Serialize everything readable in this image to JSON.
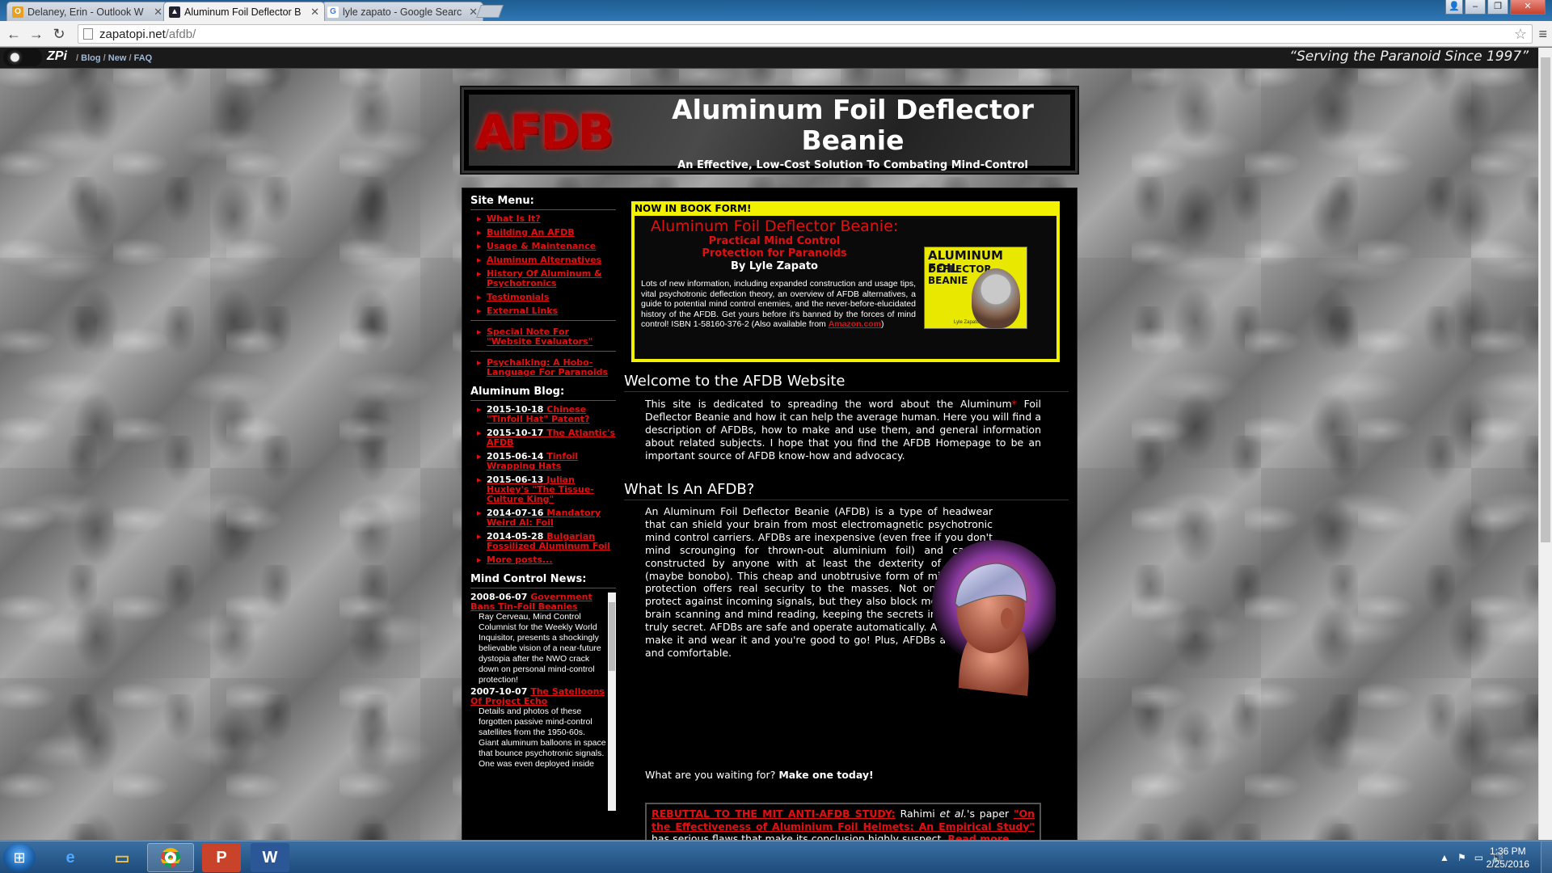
{
  "browser": {
    "tabs": [
      {
        "label": "Delaney, Erin - Outlook W",
        "icon": "outlook-icon",
        "active": false
      },
      {
        "label": "Aluminum Foil Deflector B",
        "icon": "afdb-favicon-icon",
        "active": true
      },
      {
        "label": "lyle zapato - Google Searc",
        "icon": "google-icon",
        "active": false
      }
    ],
    "url_host": "zapatopi.net",
    "url_path": "/afdb/"
  },
  "zpi_bar": {
    "site_name": "ZPi",
    "links": [
      "Blog",
      "New",
      "FAQ"
    ],
    "separator": "/",
    "tagline": "“Serving the Paranoid Since 1997”"
  },
  "banner": {
    "logo_text": "AFDB",
    "title": "Aluminum Foil Deflector Beanie",
    "subtitle": "An Effective, Low-Cost Solution To Combating Mind-Control"
  },
  "sidebar": {
    "menu_heading": "Site Menu:",
    "menu_items": [
      "What Is It?",
      "Building An AFDB",
      "Usage & Maintenance",
      "Aluminum Alternatives",
      "History Of Aluminum & Psychotronics",
      "Testimonials",
      "External Links"
    ],
    "special_items": [
      "Special Note For \"Website Evaluators\""
    ],
    "extra_items": [
      "Psychalking: A Hobo-Language For Paranoids"
    ],
    "blog_heading": "Aluminum Blog:",
    "blog_posts": [
      {
        "date": "2015-10-18",
        "title": "Chinese \"Tinfoil Hat\" Patent?"
      },
      {
        "date": "2015-10-17",
        "title": "The Atlantic's AFDB"
      },
      {
        "date": "2015-06-14",
        "title": "Tinfoil Wrapping Hats"
      },
      {
        "date": "2015-06-13",
        "title": "Julian Huxley's \"The Tissue-Culture King\""
      },
      {
        "date": "2014-07-16",
        "title": "Mandatory Weird Al: Foil"
      },
      {
        "date": "2014-05-28",
        "title": "Bulgarian Fossilized Aluminum Foil"
      }
    ],
    "more_posts": "More posts...",
    "news_heading": "Mind Control News:",
    "news": [
      {
        "date": "2008-06-07",
        "title": "Government Bans Tin-Foil Beanies",
        "body": "Ray Cerveau, Mind Control Columnist for the Weekly World Inquisitor, presents a shockingly believable vision of a near-future dystopia after the NWO crack down on personal mind-control protection!"
      },
      {
        "date": "2007-10-07",
        "title": "The Satelloons Of Project Echo",
        "body": "Details and photos of these forgotten passive mind-control satellites from the 1950-60s. Giant aluminum balloons in space that bounce psychotronic signals. One was even deployed inside"
      }
    ]
  },
  "book": {
    "header": "NOW IN BOOK FORM!",
    "title": "Aluminum Foil Deflector Beanie:",
    "subtitle_line1": "Practical Mind Control",
    "subtitle_line2": "Protection for Paranoids",
    "author": "By Lyle Zapato",
    "description": "Lots of new information, including expanded construction and usage tips, vital psychotronic deflection theory, an overview of AFDB alternatives, a guide to potential mind control enemies, and the never-before-elucidated history of the AFDB. Get yours before it's banned by the forces of mind control! ISBN 1-58160-376-2 (Also available from",
    "amazon_link": "Amazon.com",
    "desc_end": ")",
    "cover_title_1": "ALUMINUM FOIL",
    "cover_title_2": "DEFLECTOR",
    "cover_title_3": "BEANIE",
    "cover_author": "Lyle Zapato"
  },
  "welcome": {
    "heading": "Welcome to the AFDB Website",
    "text_before": "This site is dedicated to spreading the word about the Aluminum",
    "asterisk": "*",
    "text_after": " Foil Deflector Beanie and how it can help the average human. Here you will find a description of AFDBs, how to make and use them, and general information about related subjects. I hope that you find the AFDB Homepage to be an important source of AFDB know-how and advocacy."
  },
  "what_is": {
    "heading": "What Is An AFDB?",
    "text": "An Aluminum Foil Deflector Beanie (AFDB) is a type of headwear that can shield your brain from most electromagnetic psychotronic mind control carriers. AFDBs are inexpensive (even free if you don't mind scrounging for thrown-out aluminium foil) and can be constructed by anyone with at least the dexterity of a chimp (maybe bonobo). This cheap and unobtrusive form of mind control protection offers real security to the masses. Not only do they protect against incoming signals, but they also block most forms of brain scanning and mind reading, keeping the secrets in your head truly secret. AFDBs are safe and operate automatically. All you do is make it and wear it and you're good to go! Plus, AFDBs are stylish and comfortable.",
    "cta_question": "What are you waiting for?",
    "cta_bold": "Make one today!"
  },
  "rebuttal": {
    "lead": "REBUTTAL TO THE MIT ANTI-AFDB STUDY:",
    "text1": " Rahimi ",
    "etal": "et al.",
    "text2": "'s paper ",
    "paper": "\"On the Effectiveness of Aluminium Foil Helmets: An Empirical Study\"",
    "text3": " has serious flaws that make its conclusion highly suspect. ",
    "read_more": "Read more..."
  },
  "taskbar": {
    "apps": [
      "internet-explorer-icon",
      "file-explorer-icon",
      "chrome-icon",
      "powerpoint-icon",
      "word-icon"
    ],
    "time": "1:36 PM",
    "date": "2/25/2016"
  }
}
